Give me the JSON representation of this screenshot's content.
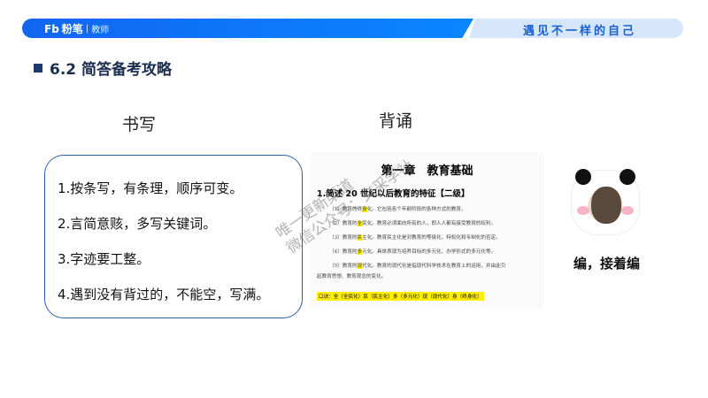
{
  "header": {
    "logo_brand": "粉笔",
    "logo_mark": "Fb",
    "logo_divider": "|",
    "logo_sub": "教师",
    "slogan": "遇见不一样的自己"
  },
  "title": "6.2 简答备考攻略",
  "columns": {
    "left": "书写",
    "right": "背诵"
  },
  "writing_tips": [
    "1.按条写，有条理，顺序可变。",
    "2.言简意赅，多写关键词。",
    "3.字迹要工整。",
    "4.遇到没有背过的，不能空，写满。"
  ],
  "document": {
    "chapter": "第一章　教育基础",
    "question": "1.简述 20 世纪以后教育的特征【二级】",
    "items": [
      {
        "pre": "（1）教育的终",
        "hl": "身",
        "post": "化。它包括各个年龄阶段的各种方式的教育。"
      },
      {
        "pre": "（2）教育的",
        "hl": "全",
        "post": "民化。教育必须面向所有的人，即人人都有接受教育的权利。"
      },
      {
        "pre": "（3）教育的",
        "hl": "民",
        "post": "主化。教育民主化是对教育的等级化、特权化和专制化的否定。"
      },
      {
        "pre": "（4）教育的",
        "hl": "多",
        "post": "元化。具体表现为培养目标的多元化、办学形式的多元化等。"
      },
      {
        "pre": "（5）教育的",
        "hl": "现",
        "post": "代化。教育的现代化是指现代科学技术在教育上的运用，并由此引"
      }
    ],
    "continuation": "起教育思想、教育观念的变化。",
    "mnemonic": "口诀：全（全民化）民（民主化）多（多元化）现（现代化）身（终身化）"
  },
  "watermark": [
    "唯一更新渠道",
    "微信公众号：文采学社"
  ],
  "meme_caption": "编，接着编"
}
